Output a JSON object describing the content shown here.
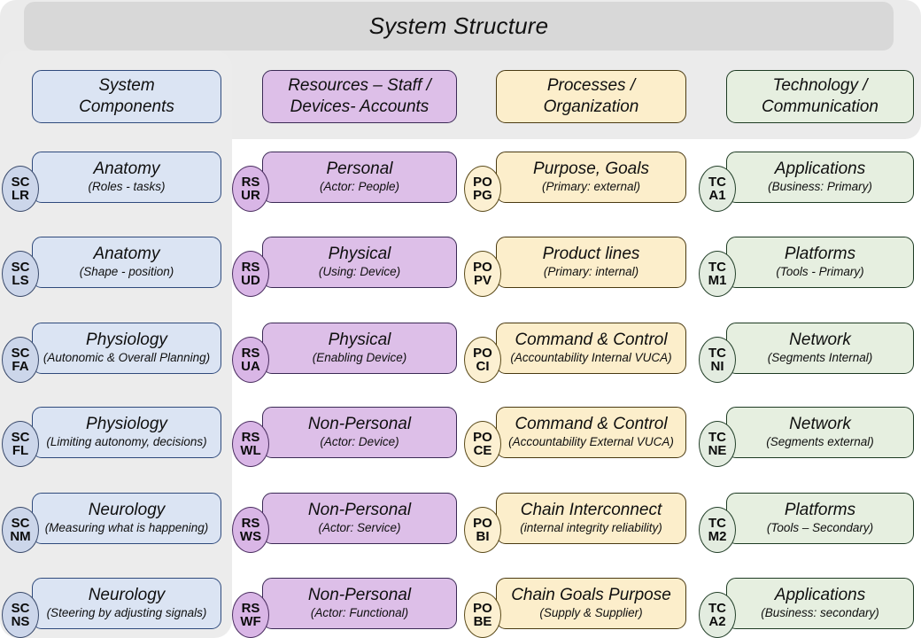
{
  "title": "System Structure",
  "columns": [
    {
      "key": "system-components",
      "header_line1": "System",
      "header_line2": "Components",
      "accent": "#dbe4f3",
      "rows": [
        {
          "code_top": "SC",
          "code_bot": "LR",
          "title": "Anatomy",
          "sub": "(Roles - tasks)"
        },
        {
          "code_top": "SC",
          "code_bot": "LS",
          "title": "Anatomy",
          "sub": "(Shape - position)"
        },
        {
          "code_top": "SC",
          "code_bot": "FA",
          "title": "Physiology",
          "sub": "(Autonomic & Overall Planning)"
        },
        {
          "code_top": "SC",
          "code_bot": "FL",
          "title": "Physiology",
          "sub": "(Limiting autonomy, decisions)"
        },
        {
          "code_top": "SC",
          "code_bot": "NM",
          "title": "Neurology",
          "sub": "(Measuring what is happening)"
        },
        {
          "code_top": "SC",
          "code_bot": "NS",
          "title": "Neurology",
          "sub": "(Steering by adjusting signals)"
        }
      ]
    },
    {
      "key": "resources",
      "header_line1": "Resources – Staff /",
      "header_line2": "Devices- Accounts",
      "accent": "#ddbfe8",
      "rows": [
        {
          "code_top": "RS",
          "code_bot": "UR",
          "title": "Personal",
          "sub": "(Actor: People)"
        },
        {
          "code_top": "RS",
          "code_bot": "UD",
          "title": "Physical",
          "sub": "(Using: Device)"
        },
        {
          "code_top": "RS",
          "code_bot": "UA",
          "title": "Physical",
          "sub": "(Enabling Device)"
        },
        {
          "code_top": "RS",
          "code_bot": "WL",
          "title": "Non-Personal",
          "sub": "(Actor: Device)"
        },
        {
          "code_top": "RS",
          "code_bot": "WS",
          "title": "Non-Personal",
          "sub": "(Actor: Service)"
        },
        {
          "code_top": "RS",
          "code_bot": "WF",
          "title": "Non-Personal",
          "sub": "(Actor: Functional)"
        }
      ]
    },
    {
      "key": "processes",
      "header_line1": "Processes /",
      "header_line2": "Organization",
      "accent": "#fceecb",
      "rows": [
        {
          "code_top": "PO",
          "code_bot": "PG",
          "title": "Purpose, Goals",
          "sub": "(Primary: external)"
        },
        {
          "code_top": "PO",
          "code_bot": "PV",
          "title": "Product lines",
          "sub": "(Primary: internal)"
        },
        {
          "code_top": "PO",
          "code_bot": "CI",
          "title": "Command & Control",
          "sub": "(Accountability Internal VUCA)"
        },
        {
          "code_top": "PO",
          "code_bot": "CE",
          "title": "Command & Control",
          "sub": "(Accountability External VUCA)"
        },
        {
          "code_top": "PO",
          "code_bot": "BI",
          "title": "Chain Interconnect",
          "sub": "(internal integrity reliability)"
        },
        {
          "code_top": "PO",
          "code_bot": "BE",
          "title": "Chain Goals Purpose",
          "sub": "(Supply & Supplier)"
        }
      ]
    },
    {
      "key": "technology",
      "header_line1": "Technology /",
      "header_line2": "Communication",
      "accent": "#e6efe0",
      "rows": [
        {
          "code_top": "TC",
          "code_bot": "A1",
          "title": "Applications",
          "sub": "(Business: Primary)"
        },
        {
          "code_top": "TC",
          "code_bot": "M1",
          "title": "Platforms",
          "sub": "(Tools - Primary)"
        },
        {
          "code_top": "TC",
          "code_bot": "NI",
          "title": "Network",
          "sub": "(Segments Internal)"
        },
        {
          "code_top": "TC",
          "code_bot": "NE",
          "title": "Network",
          "sub": "(Segments external)"
        },
        {
          "code_top": "TC",
          "code_bot": "M2",
          "title": "Platforms",
          "sub": "(Tools – Secondary)"
        },
        {
          "code_top": "TC",
          "code_bot": "A2",
          "title": "Applications",
          "sub": "(Business: secondary)"
        }
      ]
    }
  ]
}
